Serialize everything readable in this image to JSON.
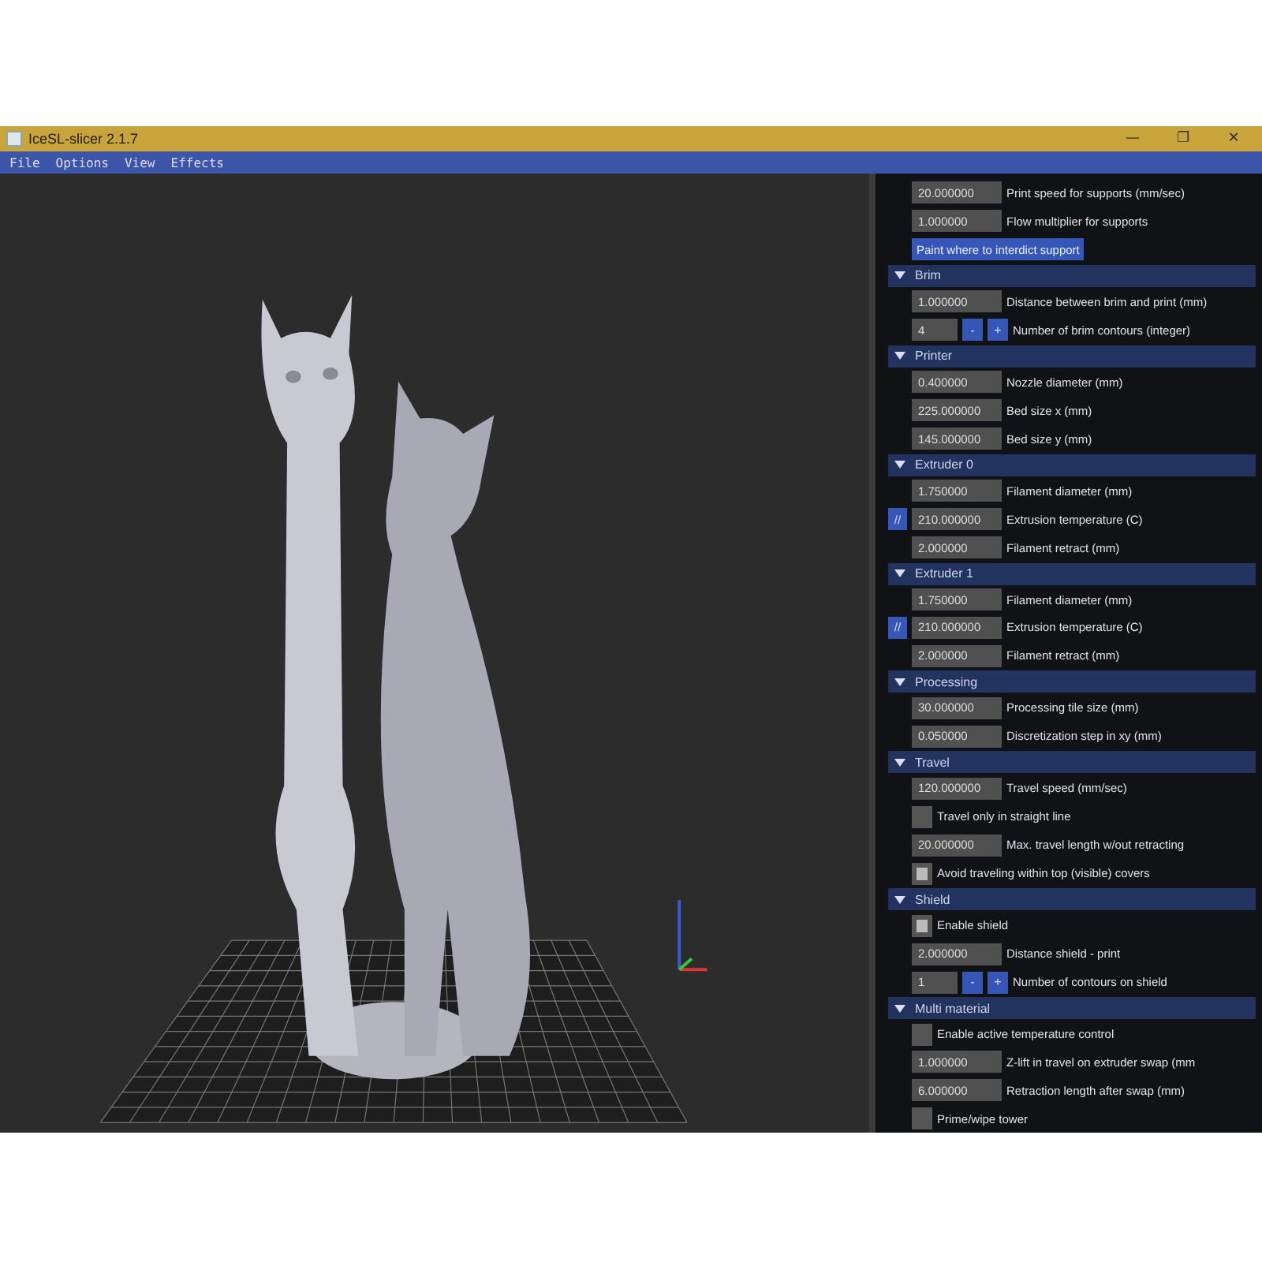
{
  "window": {
    "title": "IceSL-slicer 2.1.7",
    "controls": [
      "—",
      "❐",
      "✕"
    ]
  },
  "menu": [
    "File",
    "Options",
    "View",
    "Effects"
  ],
  "panel": {
    "sections": [
      {
        "rows": [
          {
            "kind": "number",
            "value": "20.000000",
            "label": "Print speed for supports (mm/sec)"
          },
          {
            "kind": "number",
            "value": "1.000000",
            "label": "Flow multiplier for supports"
          },
          {
            "kind": "button",
            "caption": "Paint where to interdict support"
          }
        ]
      },
      {
        "title": "Brim",
        "expanded": true,
        "rows": [
          {
            "kind": "number",
            "value": "1.000000",
            "label": "Distance between brim and print (mm)"
          },
          {
            "kind": "spin",
            "value": "4",
            "minus": "-",
            "plus": "+",
            "label": "Number of brim contours (integer)"
          }
        ]
      },
      {
        "title": "Printer",
        "expanded": true,
        "rows": [
          {
            "kind": "number",
            "value": "0.400000",
            "label": "Nozzle diameter (mm)"
          },
          {
            "kind": "number",
            "value": "225.000000",
            "label": "Bed size x (mm)"
          },
          {
            "kind": "number",
            "value": "145.000000",
            "label": "Bed size y (mm)"
          }
        ]
      },
      {
        "title": "Extruder 0",
        "expanded": true,
        "rows": [
          {
            "kind": "number",
            "value": "1.750000",
            "label": "Filament diameter (mm)"
          },
          {
            "kind": "linked",
            "link": "//",
            "value": "210.000000",
            "label": "Extrusion temperature (C)"
          },
          {
            "kind": "number",
            "value": "2.000000",
            "label": "Filament retract (mm)"
          }
        ]
      },
      {
        "title": "Extruder 1",
        "expanded": true,
        "rows": [
          {
            "kind": "number",
            "value": "1.750000",
            "label": "Filament diameter (mm)"
          },
          {
            "kind": "linked",
            "link": "//",
            "value": "210.000000",
            "label": "Extrusion temperature (C)"
          },
          {
            "kind": "number",
            "value": "2.000000",
            "label": "Filament retract (mm)"
          }
        ]
      },
      {
        "title": "Processing",
        "expanded": true,
        "rows": [
          {
            "kind": "number",
            "value": "30.000000",
            "label": "Processing tile size (mm)"
          },
          {
            "kind": "number",
            "value": "0.050000",
            "label": "Discretization step in xy (mm)"
          }
        ]
      },
      {
        "title": "Travel",
        "expanded": true,
        "rows": [
          {
            "kind": "number",
            "value": "120.000000",
            "label": "Travel speed (mm/sec)"
          },
          {
            "kind": "checkbox",
            "checked": false,
            "caption": "Travel only in straight line"
          },
          {
            "kind": "number",
            "value": "20.000000",
            "label": "Max. travel length w/out retracting"
          },
          {
            "kind": "checkbox",
            "checked": true,
            "caption": "Avoid traveling within top (visible) covers"
          }
        ]
      },
      {
        "title": "Shield",
        "expanded": true,
        "rows": [
          {
            "kind": "checkbox",
            "checked": true,
            "caption": "Enable shield"
          },
          {
            "kind": "number",
            "value": "2.000000",
            "label": "Distance shield - print"
          },
          {
            "kind": "spin",
            "value": "1",
            "minus": "-",
            "plus": "+",
            "label": "Number of contours on shield"
          }
        ]
      },
      {
        "title": "Multi material",
        "expanded": true,
        "rows": [
          {
            "kind": "checkbox",
            "checked": false,
            "caption": "Enable active temperature control"
          },
          {
            "kind": "number",
            "value": "1.000000",
            "label": "Z-lift in travel on extruder swap (mm"
          },
          {
            "kind": "number",
            "value": "6.000000",
            "label": "Retraction length after swap (mm)"
          },
          {
            "kind": "checkbox",
            "checked": false,
            "caption": "Prime/wipe tower"
          }
        ]
      }
    ]
  }
}
